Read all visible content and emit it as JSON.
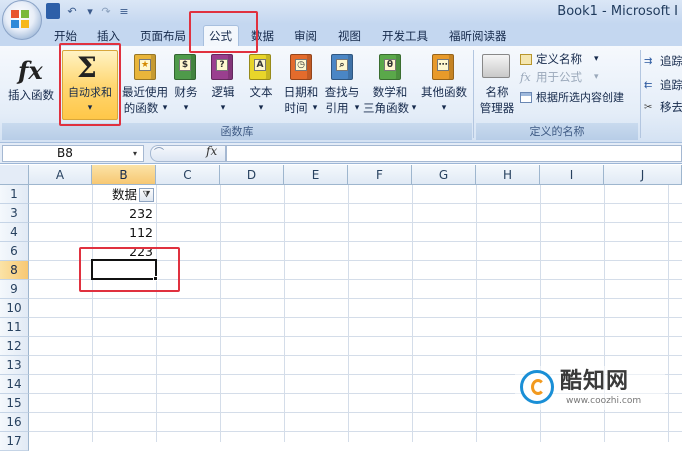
{
  "titlebar": {
    "title": "Book1 - Microsoft I",
    "quick_access": [
      "↶",
      "↷",
      "▾",
      "≡"
    ]
  },
  "tabs": [
    "开始",
    "插入",
    "页面布局",
    "公式",
    "数据",
    "审阅",
    "视图",
    "开发工具",
    "福昕阅读器"
  ],
  "active_tab": "公式",
  "ribbon": {
    "insert_function": {
      "icon": "fx",
      "label": "插入函数"
    },
    "autosum": {
      "icon": "Σ",
      "label": "自动求和",
      "arrow": "▾"
    },
    "recent": {
      "label1": "最近使用",
      "label2": "的函数",
      "arrow": "▾"
    },
    "financial": {
      "label": "财务",
      "arrow": "▾"
    },
    "logical": {
      "label": "逻辑",
      "arrow": "▾"
    },
    "text": {
      "label": "文本",
      "arrow": "▾"
    },
    "datetime": {
      "label1": "日期和",
      "label2": "时间",
      "arrow": "▾"
    },
    "lookup": {
      "label1": "查找与",
      "label2": "引用",
      "arrow": "▾"
    },
    "math": {
      "label1": "数学和",
      "label2": "三角函数",
      "arrow": "▾"
    },
    "more": {
      "label": "其他函数",
      "arrow": "▾"
    },
    "group_library": "函数库",
    "name_manager": {
      "label1": "名称",
      "label2": "管理器"
    },
    "define_name": "定义名称",
    "use_in_formula": "用于公式",
    "create_from_selection": "根据所选内容创建",
    "group_defined_names": "定义的名称",
    "trace_precedents": "追踪",
    "trace_dependents": "追踪",
    "remove_arrows": "移去"
  },
  "formula_bar": {
    "name_box": "B8",
    "fx": "fx"
  },
  "columns": [
    "A",
    "B",
    "C",
    "D",
    "E",
    "F",
    "G",
    "H",
    "I",
    "J"
  ],
  "selected_column": "B",
  "rows": [
    "1",
    "3",
    "4",
    "6",
    "8",
    "9",
    "10",
    "11",
    "12",
    "13",
    "14",
    "15",
    "16",
    "17"
  ],
  "selected_row": "8",
  "cells": {
    "B1": "数据",
    "B3": "232",
    "B4": "112",
    "B6": "223",
    "B8": ""
  },
  "filter_icon": "funnel-icon",
  "watermark": {
    "name": "酷知网",
    "url": "www.coozhi.com"
  },
  "colors": {
    "accent_red": "#e0313f",
    "selection_orange": "#f7c873",
    "ribbon_blue": "#c4d7f0"
  }
}
